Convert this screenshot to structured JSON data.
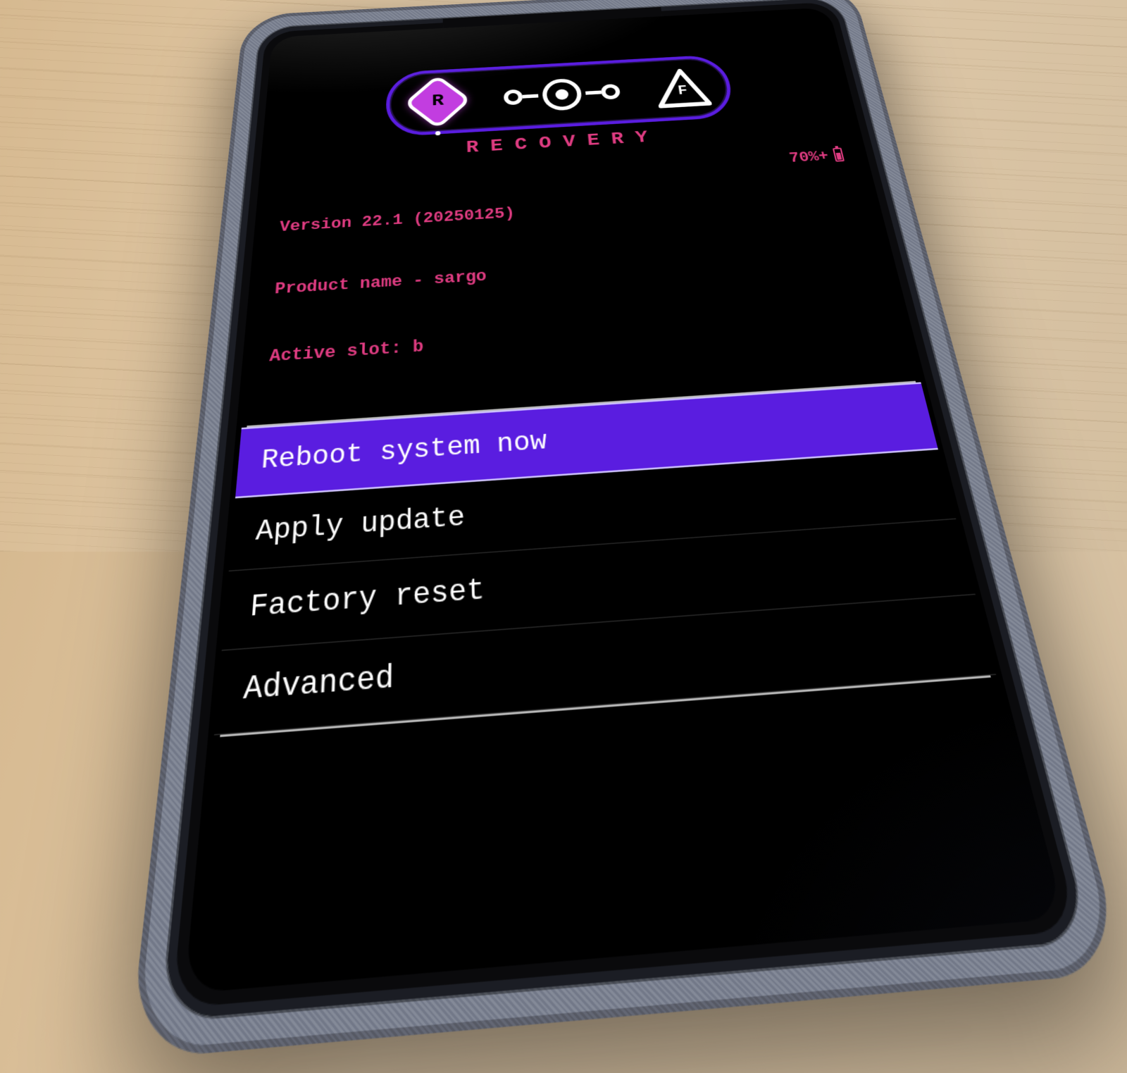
{
  "header": {
    "title": "RECOVERY",
    "badge_r_letter": "R",
    "badge_f_letter": "F"
  },
  "info": {
    "version_line": "Version 22.1 (20250125)",
    "product_line": "Product name - sargo",
    "slot_line": "Active slot: b",
    "battery": "70%+"
  },
  "menu": {
    "items": [
      {
        "label": "Reboot system now",
        "selected": true
      },
      {
        "label": "Apply update",
        "selected": false
      },
      {
        "label": "Factory reset",
        "selected": false
      },
      {
        "label": "Advanced",
        "selected": false
      }
    ]
  },
  "colors": {
    "accent_purple": "#5a1de0",
    "accent_pink": "#e03c82",
    "magenta": "#c23de0"
  }
}
